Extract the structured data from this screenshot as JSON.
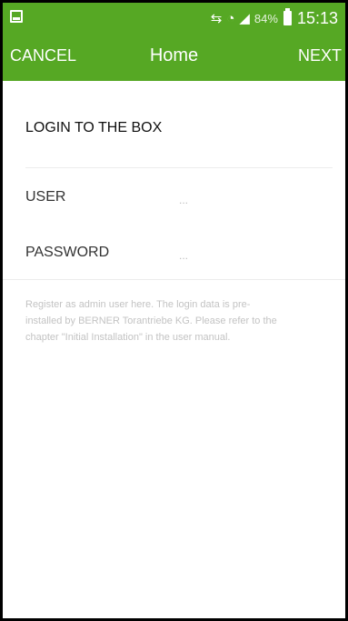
{
  "status_bar": {
    "battery_percent": "84%",
    "time": "15:13",
    "icons": [
      "gallery-icon",
      "vibrate-mute-icon",
      "wifi-icon",
      "signal-icon",
      "battery-icon"
    ]
  },
  "toolbar": {
    "cancel_label": "CANCEL",
    "title": "Home",
    "next_label": "NEXT"
  },
  "form": {
    "section_title": "LOGIN TO THE BOX",
    "user_label": "USER",
    "user_value": "...",
    "password_label": "PASSWORD",
    "password_value": "..."
  },
  "hint_text": "Register as admin user here. The login data is pre-installed by BERNER Torantriebe KG. Please refer to the chapter \"Initial Installation\" in the user manual.",
  "colors": {
    "brand_green": "#56a824",
    "hint_gray": "#c3c3c3"
  }
}
